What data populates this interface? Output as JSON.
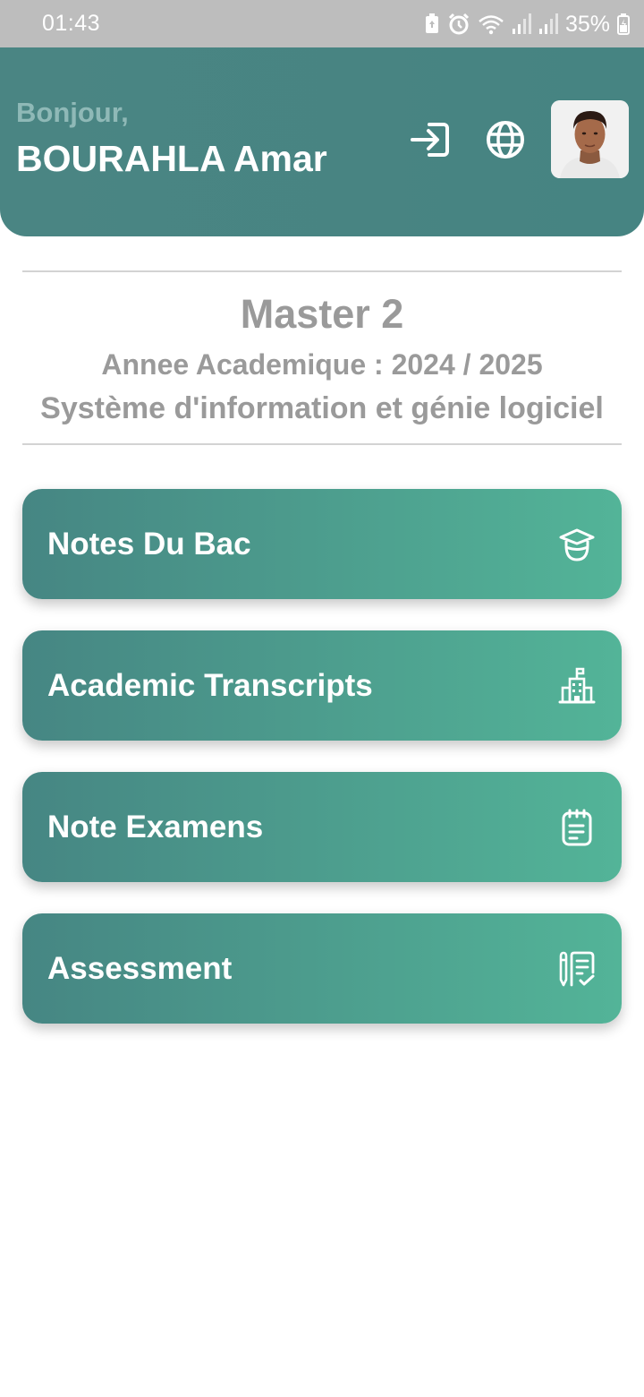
{
  "status_bar": {
    "time": "01:43",
    "battery": "35%",
    "icons": [
      "battery-saver-icon",
      "alarm-icon",
      "wifi-icon",
      "signal-icon",
      "signal-icon",
      "battery-icon"
    ]
  },
  "header": {
    "greeting": "Bonjour,",
    "user_name": "BOURAHLA Amar",
    "actions": [
      "login-icon",
      "globe-icon",
      "avatar"
    ]
  },
  "program": {
    "level": "Master 2",
    "academic_year": "Annee Academique : 2024 / 2025",
    "speciality": "Système d'information et génie logiciel"
  },
  "menu": {
    "items": [
      {
        "label": "Notes Du Bac",
        "icon": "graduate-icon"
      },
      {
        "label": "Academic Transcripts",
        "icon": "school-building-icon"
      },
      {
        "label": "Note Examens",
        "icon": "notepad-icon"
      },
      {
        "label": "Assessment",
        "icon": "checklist-icon"
      }
    ]
  },
  "colors": {
    "status_bar": "#bdbdbd",
    "header": "#488583",
    "card_start": "#468683",
    "card_end": "#53b498",
    "muted_text": "#9a9a9a"
  }
}
